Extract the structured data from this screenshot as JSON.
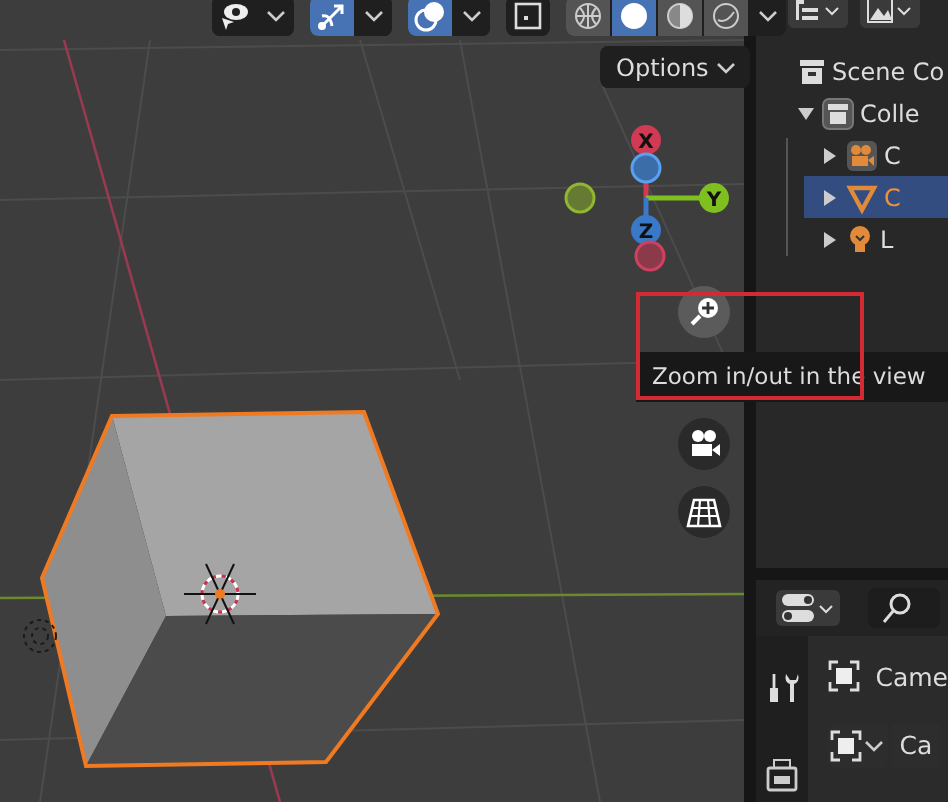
{
  "viewport": {
    "header": {
      "toggles": [
        {
          "kind": "visibility",
          "on": false
        },
        {
          "kind": "gizmo",
          "on": true
        },
        {
          "kind": "overlay",
          "on": true
        }
      ],
      "xray": {
        "on": false
      },
      "shading": [
        {
          "kind": "wireframe",
          "selected": false
        },
        {
          "kind": "solid",
          "selected": true
        },
        {
          "kind": "material",
          "selected": false
        },
        {
          "kind": "rendered",
          "selected": false
        }
      ]
    },
    "options_button": {
      "label": "Options"
    },
    "gizmo": {
      "axes": [
        {
          "label": "X"
        },
        {
          "label": "Y"
        },
        {
          "label": "Z"
        }
      ]
    },
    "nav_buttons": [
      {
        "kind": "zoom"
      },
      {
        "kind": "camera"
      },
      {
        "kind": "grid"
      }
    ],
    "tooltip": {
      "text": "Zoom in/out in the view"
    }
  },
  "outliner": {
    "items": [
      {
        "label": "Scene Co",
        "kind": "scene",
        "selected": false,
        "children": [
          {
            "label": "Colle",
            "kind": "collection",
            "selected": false,
            "expanded": true,
            "children": [
              {
                "label": "C",
                "kind": "camera",
                "selected": false,
                "expanded": false
              },
              {
                "label": "C",
                "kind": "mesh",
                "selected": true,
                "expanded": false
              },
              {
                "label": "L",
                "kind": "light",
                "selected": false,
                "expanded": false
              }
            ]
          }
        ]
      }
    ]
  },
  "properties": {
    "tabs": [
      {
        "kind": "tool",
        "selected": false
      },
      {
        "kind": "render",
        "selected": false
      }
    ],
    "object_label": "Came",
    "data_field": {
      "value": "Ca"
    }
  }
}
